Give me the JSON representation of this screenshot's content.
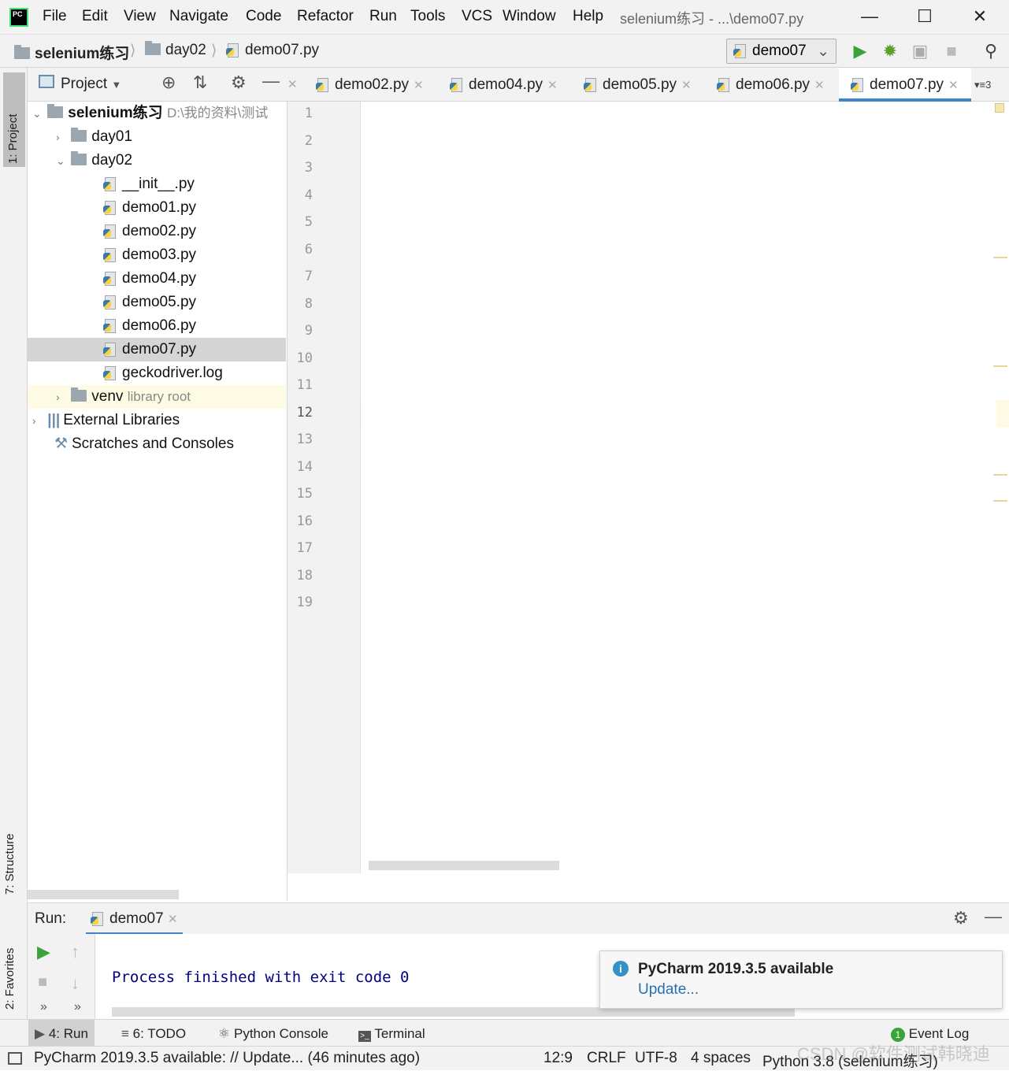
{
  "menu": {
    "items": [
      "File",
      "Edit",
      "View",
      "Navigate",
      "Code",
      "Refactor",
      "Run",
      "Tools",
      "VCS",
      "Window",
      "Help"
    ],
    "window_title": "selenium练习 - ...\\demo07.py"
  },
  "breadcrumb": {
    "project": "selenium练习",
    "folder": "day02",
    "file": "demo07.py"
  },
  "run_config": "demo07",
  "project_panel": {
    "title": "Project",
    "root": "selenium练习",
    "root_path": "D:\\我的资料\\测试",
    "tree": [
      "day01",
      "day02",
      "__init__.py",
      "demo01.py",
      "demo02.py",
      "demo03.py",
      "demo04.py",
      "demo05.py",
      "demo06.py",
      "demo07.py",
      "geckodriver.log",
      "venv",
      "External Libraries",
      "Scratches and Consoles"
    ],
    "venv_note": "library root"
  },
  "side_tabs": {
    "project": "1: Project",
    "structure": "7: Structure",
    "favorites": "2: Favorites"
  },
  "editor_tabs": [
    "demo02.py",
    "demo04.py",
    "demo05.py",
    "demo06.py",
    "demo07.py"
  ],
  "editor_tab_overflow": "3",
  "line_numbers": [
    "1",
    "2",
    "3",
    "4",
    "5",
    "6",
    "7",
    "8",
    "9",
    "10",
    "11",
    "12",
    "13",
    "14",
    "15",
    "16",
    "17",
    "18",
    "19"
  ],
  "run_panel": {
    "label": "Run:",
    "tab": "demo07",
    "output": "Process finished with exit code 0"
  },
  "notification": {
    "title": "PyCharm 2019.3.5 available",
    "link": "Update..."
  },
  "bottom_tabs": {
    "run": "4: Run",
    "todo": "6: TODO",
    "console": "Python Console",
    "terminal": "Terminal",
    "event_log": "Event Log",
    "event_count": "1"
  },
  "status": {
    "message": "PyCharm 2019.3.5 available: // Update... (46 minutes ago)",
    "position": "12:9",
    "line_sep": "CRLF",
    "encoding": "UTF-8",
    "indent": "4 spaces",
    "interpreter": "Python 3.8 (selenium练习)"
  },
  "watermark": "CSDN @软件测试韩晓迪"
}
